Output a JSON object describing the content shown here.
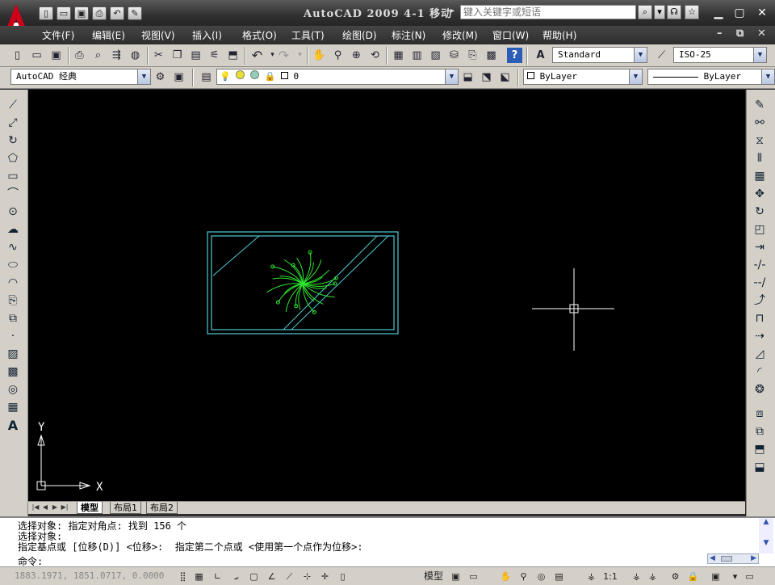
{
  "window": {
    "title": "AutoCAD 2009 4-1 移动",
    "search_placeholder": "键入关键字或短语"
  },
  "quick_access": [
    "new-icon",
    "open-icon",
    "save-icon",
    "print-icon",
    "undo-icon",
    "settings-icon"
  ],
  "menu": [
    "文件(F)",
    "编辑(E)",
    "视图(V)",
    "插入(I)",
    "格式(O)",
    "工具(T)",
    "绘图(D)",
    "标注(N)",
    "修改(M)",
    "窗口(W)",
    "帮助(H)"
  ],
  "toolbar": {
    "text_style": "Standard",
    "dim_style": "ISO-25",
    "workspace": "AutoCAD 经典",
    "layer": "0",
    "color": "ByLayer",
    "linetype": "ByLayer"
  },
  "tabs": [
    "模型",
    "布局1",
    "布局2"
  ],
  "axis": {
    "x": "X",
    "y": "Y"
  },
  "command": {
    "lines": [
      "选择对象: 指定对角点: 找到 156 个",
      "选择对象:",
      "指定基点或 [位移(D)] <位移>:  指定第二个点或 <使用第一个点作为位移>:"
    ],
    "prompt": "命令:"
  },
  "status": {
    "coords": "1883.1971, 1851.0717, 0.0000",
    "model_label": "模型",
    "annotation_scale": "1:1"
  },
  "colors": {
    "cad_rect": "#4ecbd6",
    "plant": "#2ee82e",
    "canvas": "#000000"
  }
}
